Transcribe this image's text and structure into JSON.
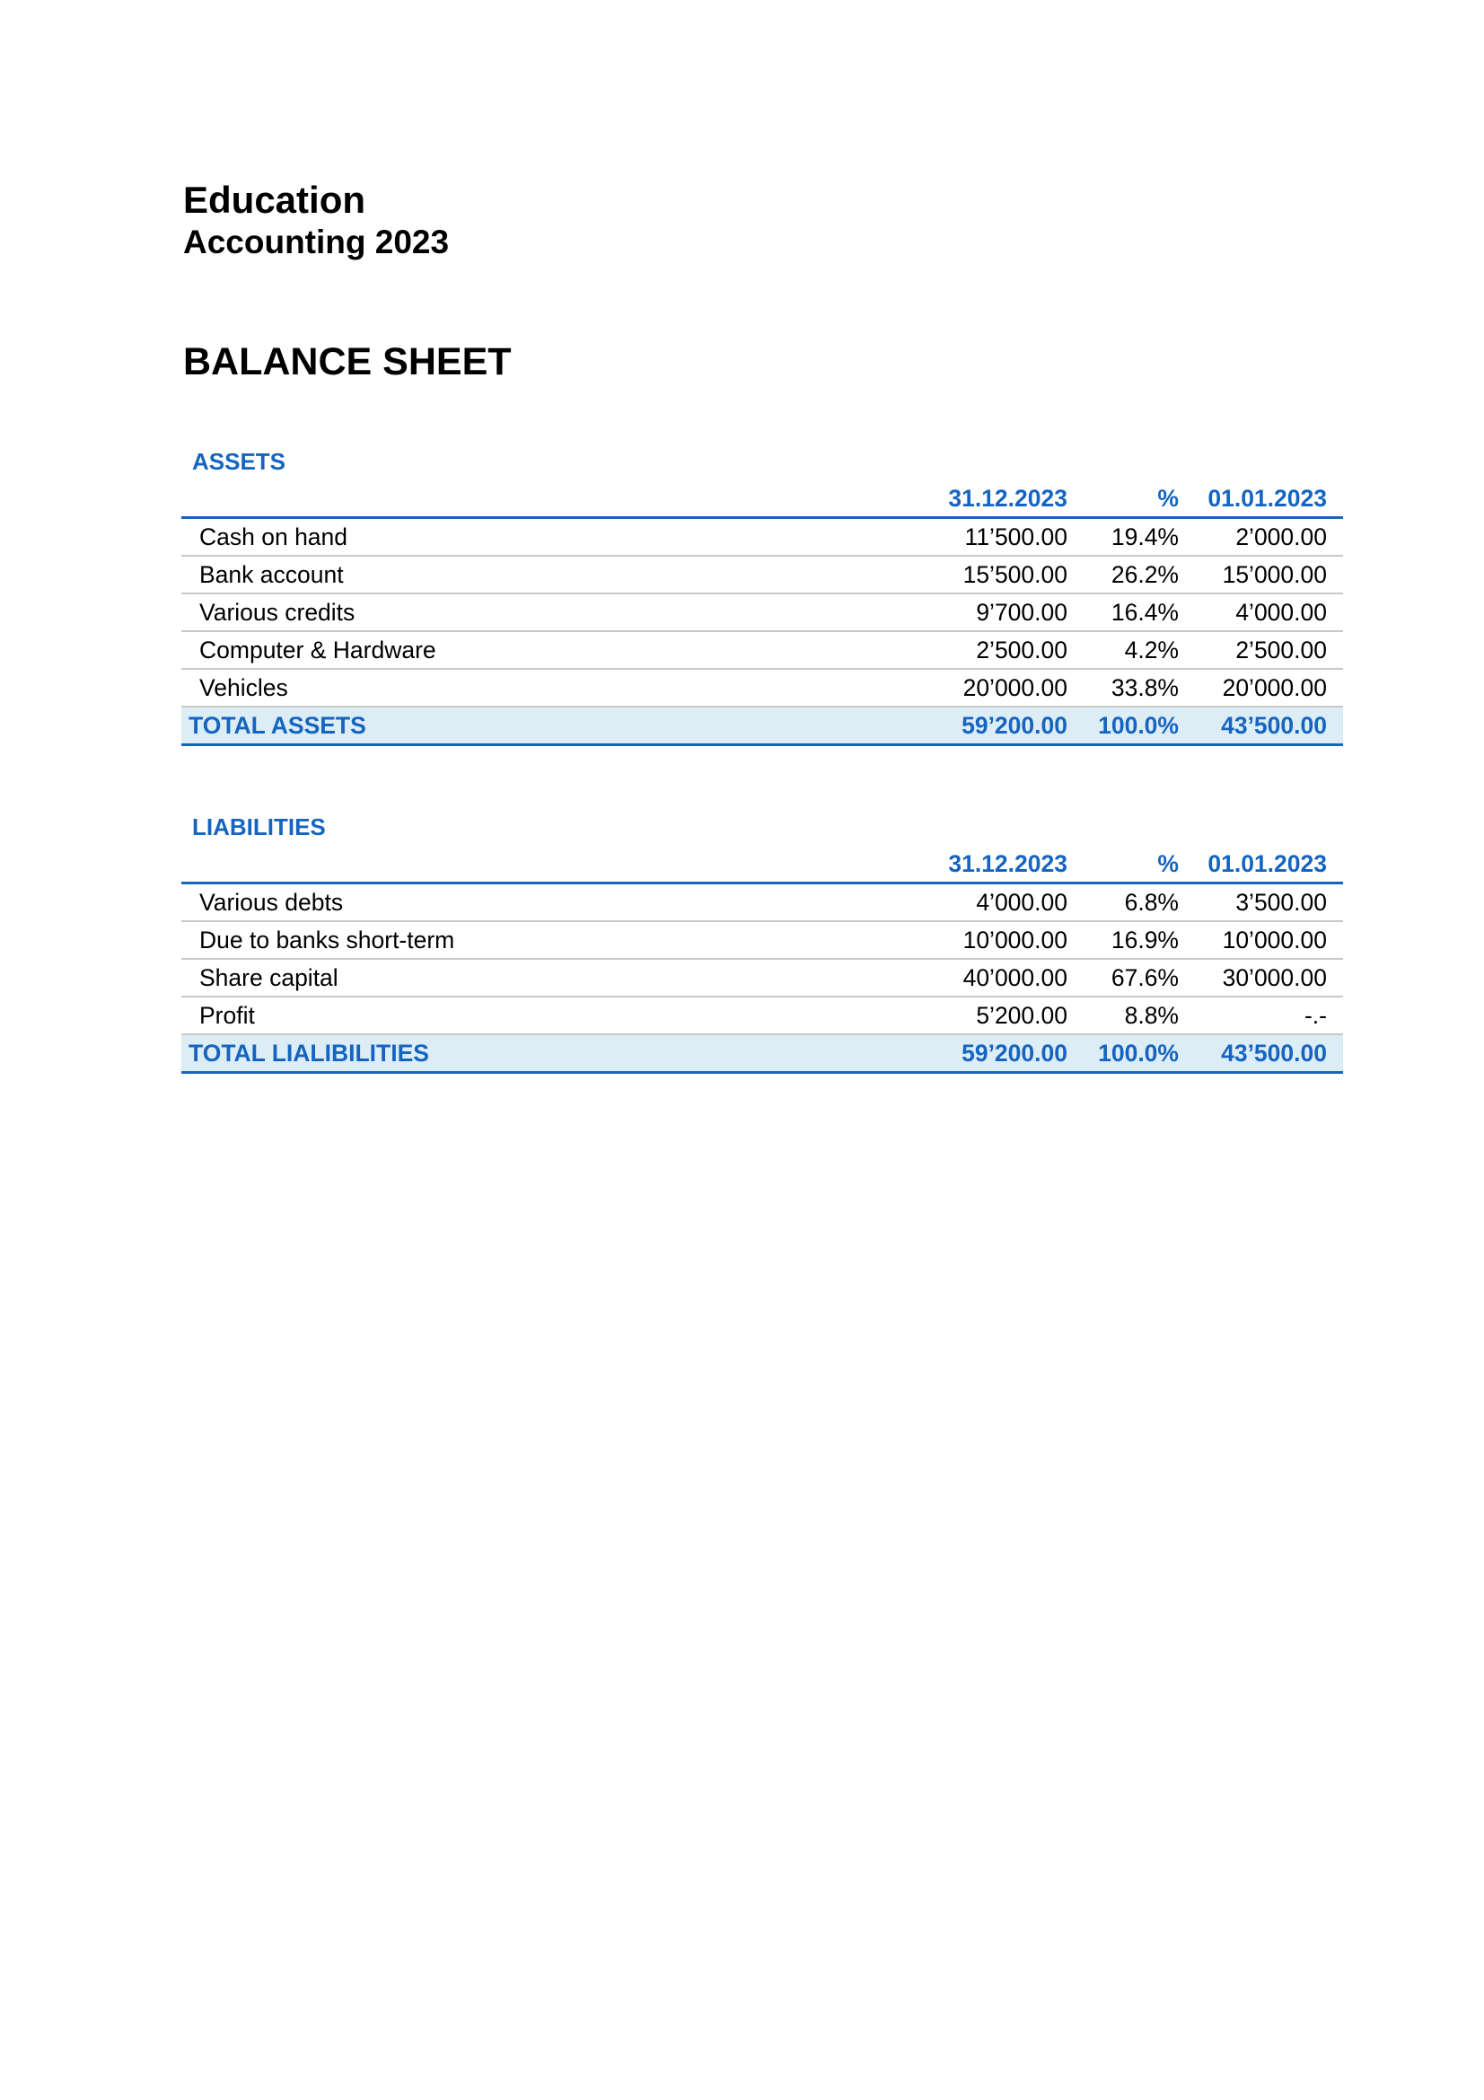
{
  "header": {
    "company": "Education",
    "subtitle": "Accounting 2023",
    "report_title": "BALANCE SHEET"
  },
  "colors": {
    "accent": "#1565c0",
    "total_row_bg": "#ddedf5",
    "row_divider": "#c8c8c8"
  },
  "assets": {
    "heading": "ASSETS",
    "columns": [
      "31.12.2023",
      "%",
      "01.01.2023"
    ],
    "rows": [
      {
        "label": "Cash on hand",
        "current": "11’500.00",
        "pct": "19.4%",
        "previous": "2’000.00"
      },
      {
        "label": "Bank account",
        "current": "15’500.00",
        "pct": "26.2%",
        "previous": "15’000.00"
      },
      {
        "label": "Various credits",
        "current": "9’700.00",
        "pct": "16.4%",
        "previous": "4’000.00"
      },
      {
        "label": "Computer & Hardware",
        "current": "2’500.00",
        "pct": "4.2%",
        "previous": "2’500.00"
      },
      {
        "label": "Vehicles",
        "current": "20’000.00",
        "pct": "33.8%",
        "previous": "20’000.00"
      }
    ],
    "total": {
      "label": "TOTAL ASSETS",
      "current": "59’200.00",
      "pct": "100.0%",
      "previous": "43’500.00"
    }
  },
  "liabilities": {
    "heading": "LIABILITIES",
    "columns": [
      "31.12.2023",
      "%",
      "01.01.2023"
    ],
    "rows": [
      {
        "label": "Various debts",
        "current": "4’000.00",
        "pct": "6.8%",
        "previous": "3’500.00"
      },
      {
        "label": "Due to banks short-term",
        "current": "10’000.00",
        "pct": "16.9%",
        "previous": "10’000.00"
      },
      {
        "label": "Share capital",
        "current": "40’000.00",
        "pct": "67.6%",
        "previous": "30’000.00"
      },
      {
        "label": "Profit",
        "current": "5’200.00",
        "pct": "8.8%",
        "previous": "-.-"
      }
    ],
    "total": {
      "label": "TOTAL LIALIBILITIES",
      "current": "59’200.00",
      "pct": "100.0%",
      "previous": "43’500.00"
    }
  }
}
